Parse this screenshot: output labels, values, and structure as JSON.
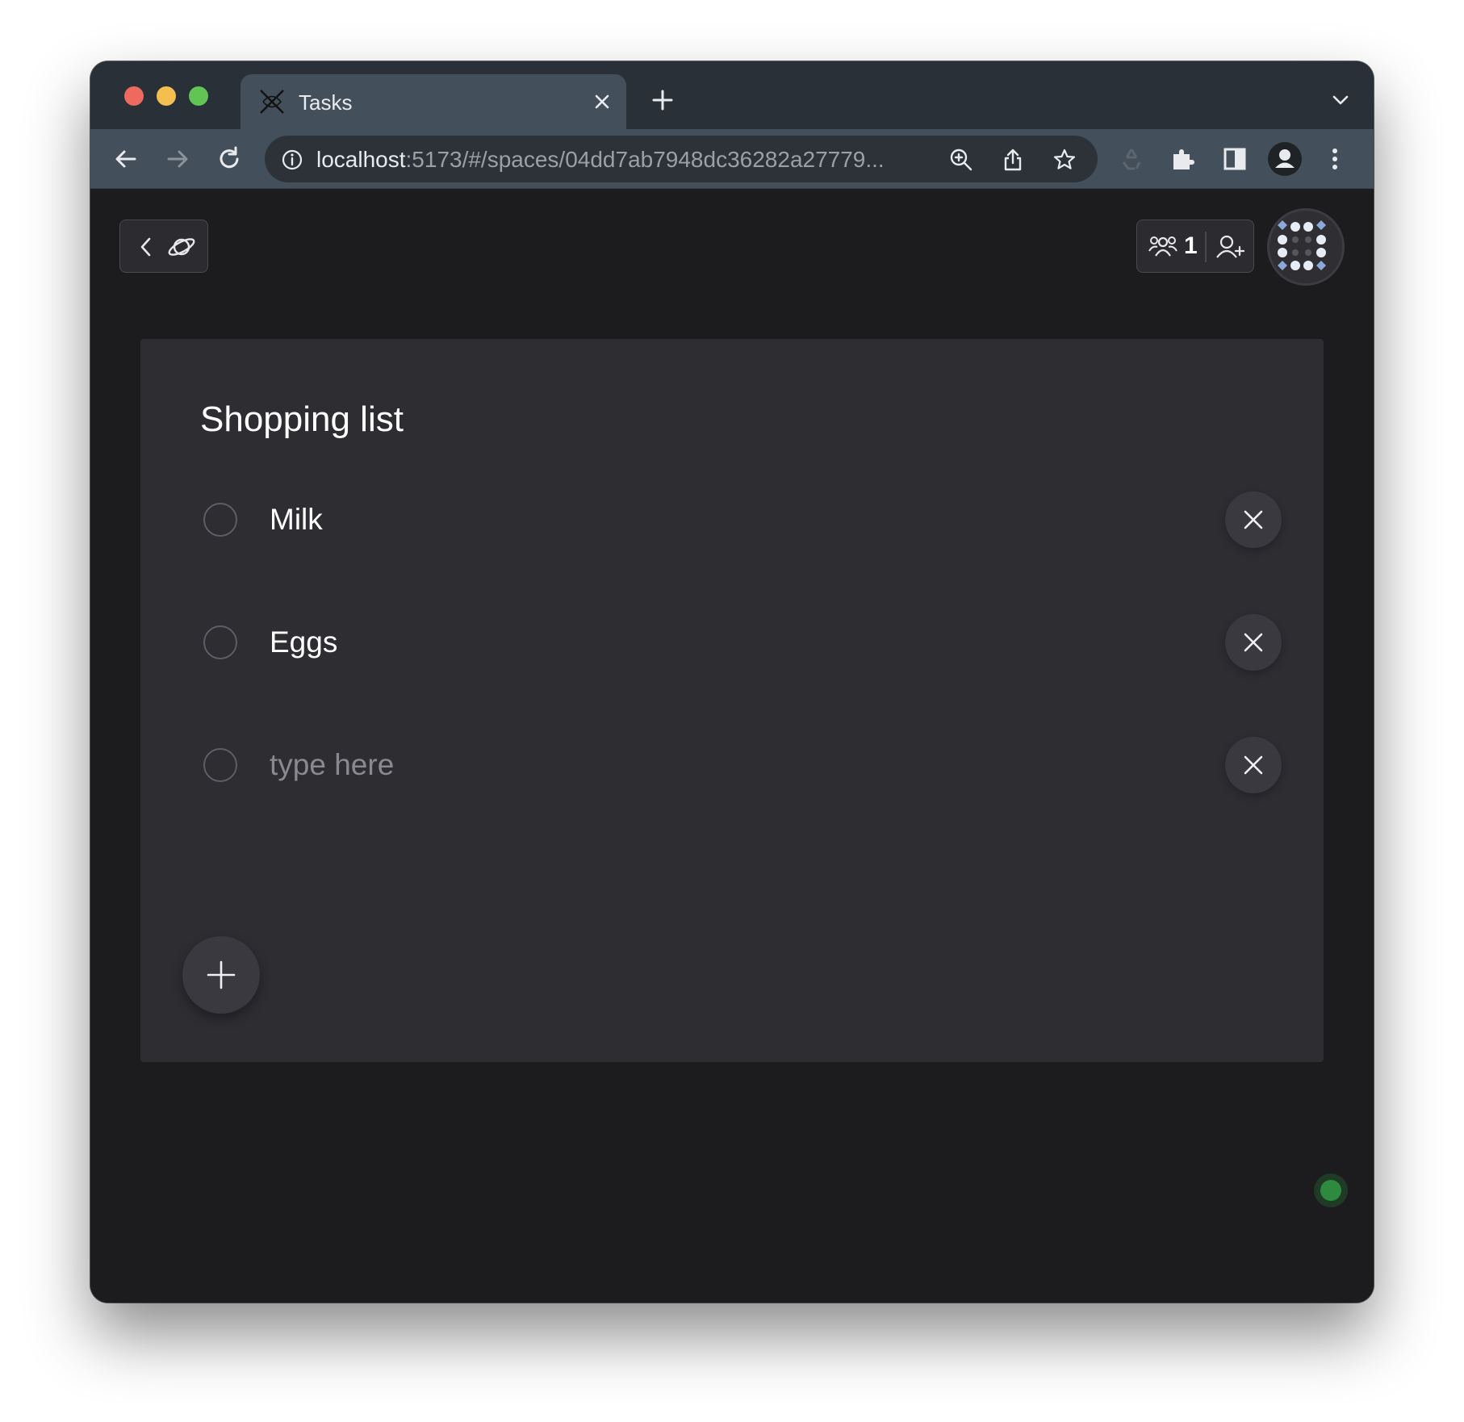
{
  "browser": {
    "tab_title": "Tasks",
    "url_host": "localhost",
    "url_rest": ":5173/#/spaces/04dd7ab7948dc36282a27779..."
  },
  "header": {
    "presence_count": "1"
  },
  "list": {
    "title": "Shopping list",
    "items": [
      {
        "text": "Milk",
        "checked": false
      },
      {
        "text": "Eggs",
        "checked": false
      }
    ],
    "new_item_placeholder": "type here"
  },
  "colors": {
    "background": "#1c1c1e",
    "card": "#2e2d32",
    "status_online": "#2e8a3f"
  }
}
